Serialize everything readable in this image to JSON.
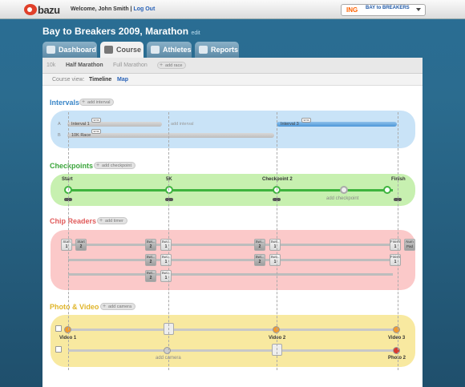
{
  "header": {
    "logo_text": "bazu",
    "welcome": "Welcome, John Smith |",
    "logout": "Log Out",
    "sponsor_ing": "ING",
    "sponsor_btb": "BAY to BREAKERS"
  },
  "event": {
    "title": "Bay to Breakers 2009, Marathon",
    "edit": "edit"
  },
  "tabs": [
    {
      "label": "Dashboard"
    },
    {
      "label": "Course"
    },
    {
      "label": "Athletes"
    },
    {
      "label": "Reports"
    }
  ],
  "races": {
    "items": [
      "10k",
      "Half Marathon",
      "Full Marathon"
    ],
    "add": "add race"
  },
  "course_view": {
    "label": "Course view:",
    "timeline": "Timeline",
    "map": "Map"
  },
  "intervals": {
    "title": "Intervals",
    "add": "add interval",
    "rows": [
      {
        "key": "A",
        "bars": [
          {
            "label": "Interval 1"
          },
          {
            "label": "add interval"
          },
          {
            "label": "Interval 3"
          }
        ]
      },
      {
        "key": "B",
        "bars": [
          {
            "label": "10K Race"
          }
        ]
      }
    ],
    "sms": "sms"
  },
  "checkpoints": {
    "title": "Checkpoints",
    "add": "add checkpoint",
    "nodes": [
      "Start",
      "5K",
      "Checkpoint 2",
      "Finish"
    ],
    "add_inline": "add checkpoint"
  },
  "chip_readers": {
    "title": "Chip Readers",
    "add": "add timer",
    "start": "Start",
    "finish": "Finish",
    "switch": "Swi...",
    "num_pad": "Num Pad",
    "n1": "1",
    "n2": "2"
  },
  "photo_video": {
    "title": "Photo & Video",
    "add": "add camera",
    "labels": [
      "Video 1",
      "Video 2",
      "Video 3",
      "add camera",
      "Photo 2"
    ]
  },
  "colors": {
    "interval_band": "#c9e3f7",
    "checkpoint_band": "#c7f0b0",
    "chip_band": "#fbc9c9",
    "photo_band": "#f8e9a0",
    "interval_title": "#3b87c8",
    "checkpoint_title": "#3aa53a",
    "chip_title": "#e15b5b",
    "photo_title": "#e0b52a"
  }
}
